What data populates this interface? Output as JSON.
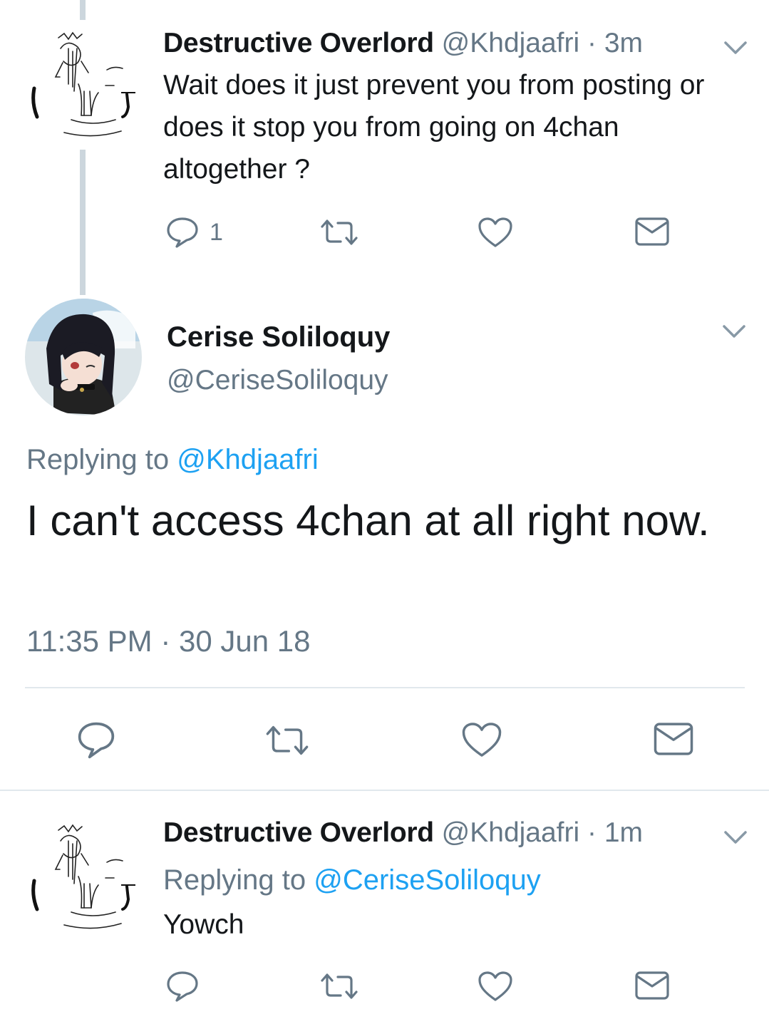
{
  "tweets": [
    {
      "author": "Destructive Overlord",
      "handle": "@Khdjaafri",
      "time": "3m",
      "text": "Wait does it just prevent you from posting or does it stop you from going on 4chan altogether ?",
      "reply_count": "1",
      "avatar_icon": "sketch-avatar-icon"
    },
    {
      "author": "Destructive Overlord",
      "handle": "@Khdjaafri",
      "time": "1m",
      "replying_label": "Replying to",
      "replying_to": "@CeriseSoliloquy",
      "text": "Yowch",
      "avatar_icon": "sketch-avatar-icon"
    }
  ],
  "focus": {
    "author": "Cerise Soliloquy",
    "handle": "@CeriseSoliloquy",
    "replying_label": "Replying to",
    "replying_to": "@Khdjaafri",
    "text": "I can't access 4chan at all right now.",
    "timestamp": "11:35 PM · 30 Jun 18",
    "avatar_icon": "anime-avatar-icon"
  },
  "separator": " · ",
  "icons": [
    "reply-icon",
    "retweet-icon",
    "like-icon",
    "dm-icon",
    "chevron-down-icon"
  ],
  "colors": {
    "link": "#1da1f2",
    "muted": "#657786",
    "thread": "#ccd6dd",
    "divider": "#e1e8ed"
  }
}
